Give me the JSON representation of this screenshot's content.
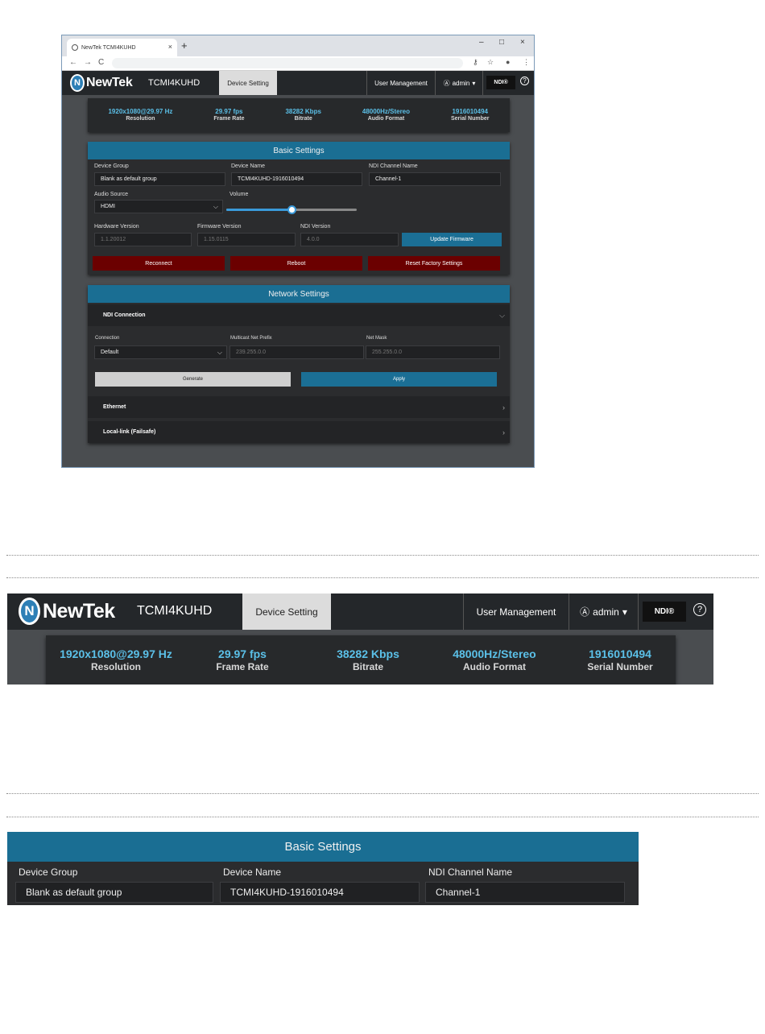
{
  "browser": {
    "tab_title": "NewTek TCMI4KUHD",
    "tab_close": "×",
    "new_tab": "+",
    "minimize": "–",
    "maximize": "□",
    "close": "×",
    "back": "←",
    "forward": "→",
    "reload": "C",
    "key_icon": "⚷",
    "star_icon": "☆",
    "account_icon": "●",
    "menu_icon": "⋮"
  },
  "app": {
    "brand": "NewTek",
    "brand_mark": "N",
    "device_name": "TCMI4KUHD",
    "nav": {
      "device_setting": "Device Setting",
      "user_management": "User Management",
      "user": "admin",
      "user_caret": "▾",
      "user_icon": "Ⓐ",
      "ndi": "NDI®",
      "help": "?"
    },
    "status": [
      {
        "value": "1920x1080@29.97 Hz",
        "label": "Resolution"
      },
      {
        "value": "29.97 fps",
        "label": "Frame Rate"
      },
      {
        "value": "38282 Kbps",
        "label": "Bitrate"
      },
      {
        "value": "48000Hz/Stereo",
        "label": "Audio Format"
      },
      {
        "value": "1916010494",
        "label": "Serial Number"
      }
    ],
    "basic": {
      "title": "Basic Settings",
      "device_group_label": "Device Group",
      "device_group_value": "Blank as default group",
      "device_name_label": "Device Name",
      "device_name_value": "TCMI4KUHD-1916010494",
      "ndi_channel_label": "NDI Channel Name",
      "ndi_channel_value": "Channel-1",
      "audio_source_label": "Audio Source",
      "audio_source_value": "HDMI",
      "volume_label": "Volume",
      "volume_level": 0.5,
      "hw_label": "Hardware Version",
      "hw_value": "1.1.20012",
      "fw_label": "Firmware Version",
      "fw_value": "1.15.0115",
      "ndi_ver_label": "NDI Version",
      "ndi_ver_value": "4.0.0",
      "update_fw": "Update Firmware",
      "reconnect": "Reconnect",
      "reboot": "Reboot",
      "reset": "Reset Factory Settings"
    },
    "network": {
      "title": "Network Settings",
      "ndi_connection": "NDI Connection",
      "connection_label": "Connection",
      "connection_value": "Default",
      "multicast_label": "Multicast Net Prefix",
      "multicast_value": "239.255.0.0",
      "netmask_label": "Net Mask",
      "netmask_value": "255.255.0.0",
      "generate": "Generate",
      "apply": "Apply",
      "ethernet": "Ethernet",
      "locallink": "Local-link (Failsafe)",
      "chev_down": "⌵",
      "chev_right": "›",
      "select_caret": "⌵"
    }
  },
  "colors": {
    "accent_blue": "#1a6e93",
    "stat_blue": "#5bc0e8",
    "danger_red": "#6b0000",
    "header_bg": "#24272a"
  }
}
